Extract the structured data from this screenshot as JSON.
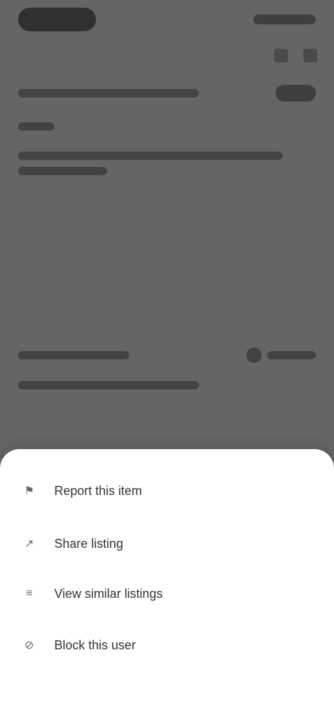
{
  "sheet": {
    "items": [
      {
        "label": "Report this item",
        "icon": "flag-icon"
      },
      {
        "label": "Share listing",
        "icon": "share-icon"
      },
      {
        "label": "View similar listings",
        "icon": "list-icon"
      },
      {
        "label": "Block this user",
        "icon": "block-icon"
      }
    ]
  }
}
